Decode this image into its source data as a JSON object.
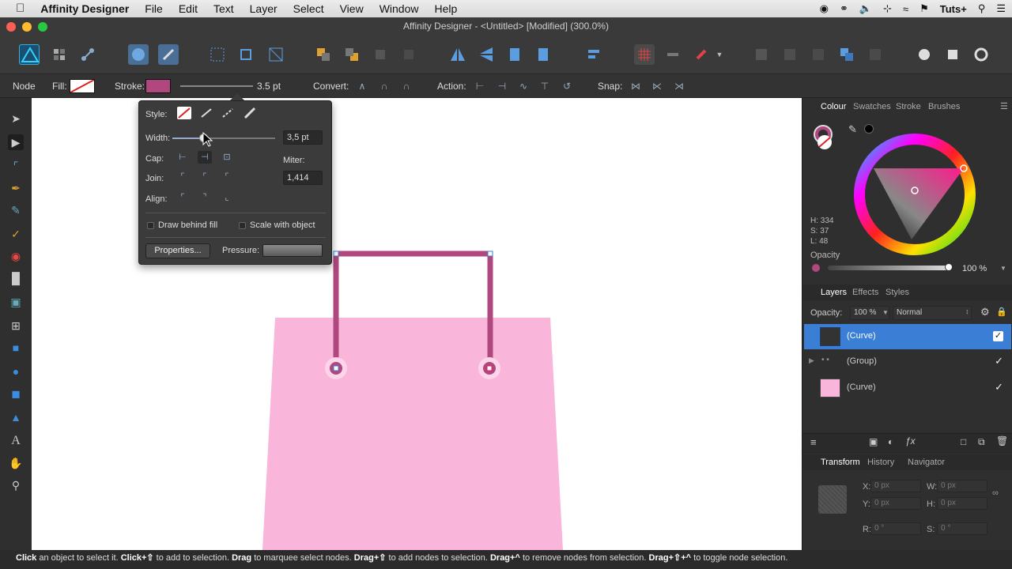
{
  "menubar": {
    "app": "Affinity Designer",
    "items": [
      "File",
      "Edit",
      "Text",
      "Layer",
      "Select",
      "View",
      "Window",
      "Help"
    ],
    "right_user": "Tuts+"
  },
  "window": {
    "title": "Affinity Designer - <Untitled> [Modified] (300.0%)"
  },
  "context": {
    "mode": "Node",
    "fill_label": "Fill:",
    "stroke_label": "Stroke:",
    "stroke_width": "3.5 pt",
    "convert_label": "Convert:",
    "action_label": "Action:",
    "snap_label": "Snap:",
    "stroke_color": "#b0477e"
  },
  "stroke_popup": {
    "style_label": "Style:",
    "width_label": "Width:",
    "width_value": "3,5 pt",
    "width_fraction": 0.3,
    "cap_label": "Cap:",
    "join_label": "Join:",
    "align_label": "Align:",
    "miter_label": "Miter:",
    "miter_value": "1,414",
    "draw_behind_fill": "Draw behind fill",
    "scale_with_object": "Scale with object",
    "properties_button": "Properties...",
    "pressure_label": "Pressure:"
  },
  "colour_panel": {
    "tabs": [
      "Colour",
      "Swatches",
      "Stroke",
      "Brushes"
    ],
    "active_tab": "Colour",
    "h": "H: 334",
    "s": "S: 37",
    "l": "L: 48",
    "opacity_label": "Opacity",
    "opacity_value": "100 %"
  },
  "layers_panel": {
    "tabs": [
      "Layers",
      "Effects",
      "Styles"
    ],
    "active_tab": "Layers",
    "opacity_label": "Opacity:",
    "opacity_value": "100 %",
    "blend_mode": "Normal",
    "layers": [
      {
        "name": "(Curve)",
        "selected": true
      },
      {
        "name": "(Group)",
        "selected": false
      },
      {
        "name": "(Curve)",
        "selected": false
      }
    ]
  },
  "transform_panel": {
    "tabs": [
      "Transform",
      "History",
      "Navigator"
    ],
    "active_tab": "Transform",
    "x_label": "X:",
    "x_value": "0 px",
    "y_label": "Y:",
    "y_value": "0 px",
    "w_label": "W:",
    "w_value": "0 px",
    "h_label": "H:",
    "h_value": "0 px",
    "r_label": "R:",
    "r_value": "0 °",
    "s_label": "S:",
    "s_value": "0 °"
  },
  "status": {
    "p1b": "Click",
    "p1": " an object to select it. ",
    "p2b": "Click+⇧",
    "p2": " to add to selection. ",
    "p3b": "Drag",
    "p3": " to marquee select nodes. ",
    "p4b": "Drag+⇧",
    "p4": " to add nodes to selection. ",
    "p5b": "Drag+^",
    "p5": " to remove nodes from selection. ",
    "p6b": "Drag+⇧+^",
    "p6": " to toggle node selection."
  },
  "colors": {
    "accent": "#3a7fd5",
    "bag_fill": "#f9b5da",
    "handle_stroke": "#b0477e"
  }
}
